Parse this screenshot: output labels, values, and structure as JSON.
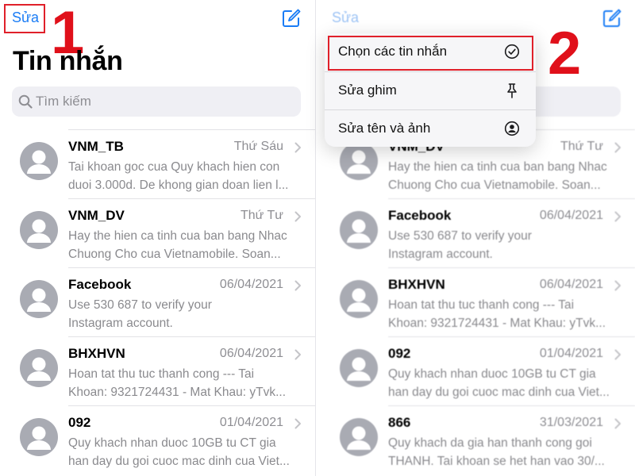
{
  "left": {
    "edit_label": "Sửa",
    "step": "1",
    "title": "Tin nhắn",
    "search_placeholder": "Tìm kiếm",
    "messages": [
      {
        "sender": "VNM_TB",
        "date": "Thứ Sáu",
        "line1": "Tai khoan goc cua Quy khach hien con",
        "line2": "duoi 3.000d. De khong gian doan lien l..."
      },
      {
        "sender": "VNM_DV",
        "date": "Thứ Tư",
        "line1": "Hay the hien ca tinh cua ban bang Nhac",
        "line2": "Chuong Cho cua Vietnamobile. Soan..."
      },
      {
        "sender": "Facebook",
        "date": "06/04/2021",
        "line1": "Use 530 687 to verify your",
        "line2": "Instagram account."
      },
      {
        "sender": "BHXHVN",
        "date": "06/04/2021",
        "line1": "Hoan tat thu tuc thanh cong --- Tai",
        "line2": "Khoan: 9321724431 - Mat Khau: yTvk..."
      },
      {
        "sender": "092",
        "date": "01/04/2021",
        "line1": "Quy khach nhan duoc 10GB tu CT gia",
        "line2": "han day du goi cuoc mac dinh cua Viet..."
      }
    ]
  },
  "right": {
    "edit_label": "Sửa",
    "step": "2",
    "menu": [
      {
        "label": "Chọn các tin nhắn",
        "icon": "check-circle-icon"
      },
      {
        "label": "Sửa ghim",
        "icon": "pin-icon"
      },
      {
        "label": "Sửa tên và ảnh",
        "icon": "person-circle-icon"
      }
    ],
    "messages": [
      {
        "sender": "VNM_DV",
        "date": "Thứ Tư",
        "line1": "Hay the hien ca tinh cua ban bang Nhac",
        "line2": "Chuong Cho cua Vietnamobile. Soan..."
      },
      {
        "sender": "Facebook",
        "date": "06/04/2021",
        "line1": "Use 530 687 to verify your",
        "line2": "Instagram account."
      },
      {
        "sender": "BHXHVN",
        "date": "06/04/2021",
        "line1": "Hoan tat thu tuc thanh cong --- Tai",
        "line2": "Khoan: 9321724431 - Mat Khau: yTvk..."
      },
      {
        "sender": "092",
        "date": "01/04/2021",
        "line1": "Quy khach nhan duoc 10GB tu CT gia",
        "line2": "han day du goi cuoc mac dinh cua Viet..."
      },
      {
        "sender": "866",
        "date": "31/03/2021",
        "line1": "Quy khach da gia han thanh cong goi",
        "line2": "THANH. Tai khoan se het han vao 30/..."
      }
    ]
  },
  "colors": {
    "accent": "#1a7cf5",
    "annotation": "#e0202a",
    "secondary_text": "#8e8e93"
  }
}
